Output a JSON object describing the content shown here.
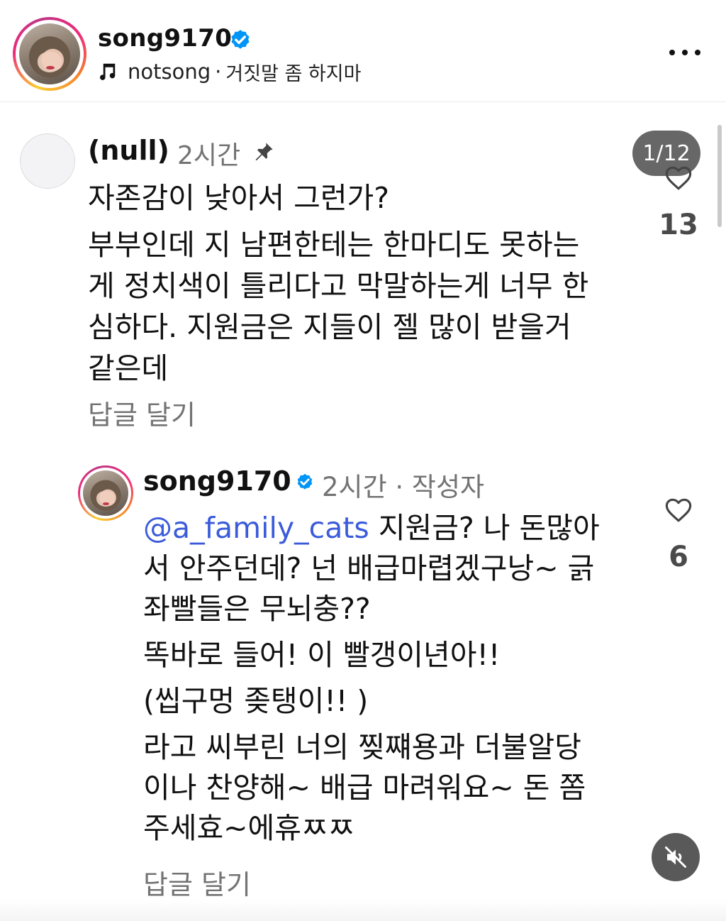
{
  "header": {
    "username": "song9170",
    "verified": true,
    "music": {
      "artist": "notsong",
      "separator": "·",
      "song": "거짓말 좀 하지마"
    },
    "more_icon": "more-horizontal-icon"
  },
  "pager": {
    "label": "1/12"
  },
  "comments": [
    {
      "username": "(null)",
      "time": "2시간",
      "pinned": true,
      "lines": [
        "자존감이 낮아서 그런가?",
        "부부인데 지 남편한테는 한마디도 못하는",
        "게 정치색이 틀리다고 막말하는게 너무 한",
        "심하다. 지원금은 지들이 젤 많이 받을거",
        "같은데"
      ],
      "reply_label": "답글 달기",
      "likes": "13"
    },
    {
      "username": "song9170",
      "verified": true,
      "time": "2시간 · 작성자",
      "mention": "@a_family_cats",
      "lines": [
        " 지원금? 나 돈많아",
        "서 안주던데? 넌 배급마렵겠구낭~ 긁",
        "좌빨들은 무뇌충??",
        "똑바로 들어! 이 빨갱이년아!!",
        "(씹구멍 좆탱이!! )",
        "라고 씨부린 너의 찢쨰용과 더불알당",
        "이나 찬양해~ 배급 마려워요~ 돈 쫌",
        "주세효~에휴ㅉㅉ"
      ],
      "reply_label": "답글 달기",
      "likes": "6"
    }
  ],
  "controls": {
    "mute_icon": "speaker-muted-icon"
  },
  "colors": {
    "text": "#111111",
    "secondary": "#737373",
    "mention": "#3b5bdb",
    "verified_blue": "#0095f6",
    "overlay": "#464646"
  }
}
